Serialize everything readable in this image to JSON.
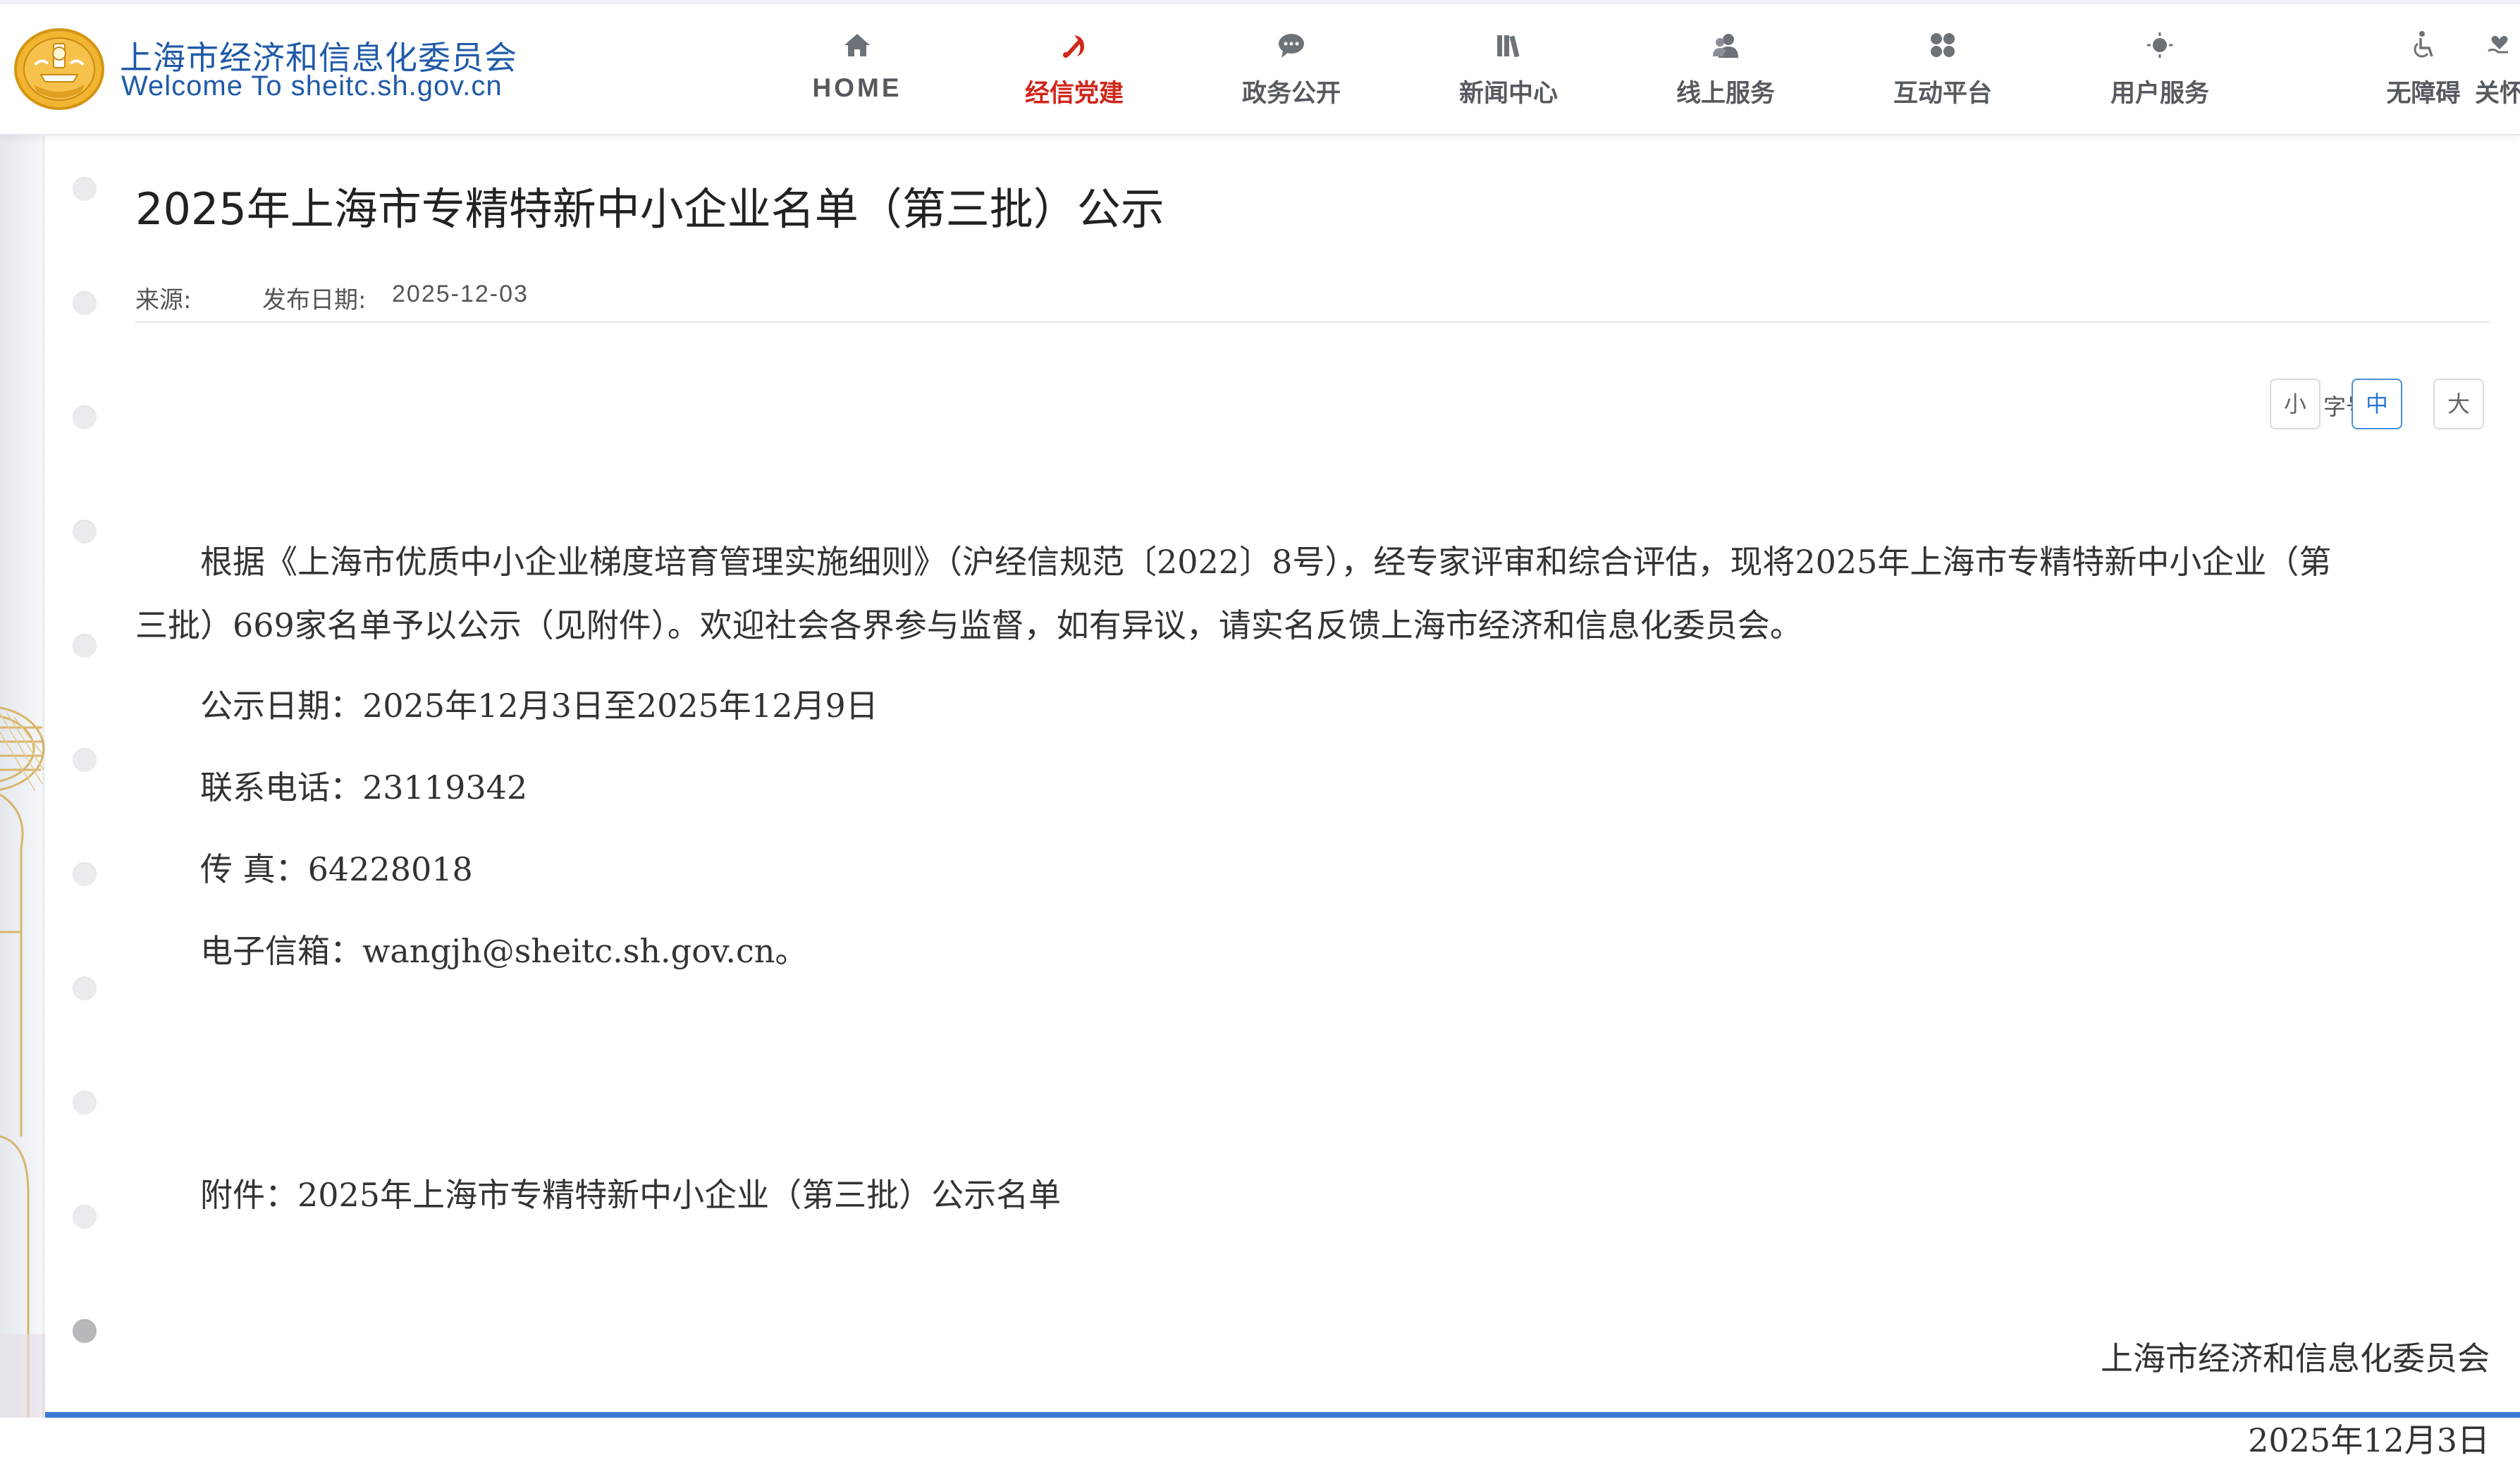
{
  "header": {
    "site_name_cn": "上海市经济和信息化委员会",
    "site_name_en": "Welcome To sheitc.sh.gov.cn",
    "nav": [
      {
        "label": "HOME",
        "icon": "home-icon"
      },
      {
        "label": "经信党建",
        "icon": "party-emblem-icon"
      },
      {
        "label": "政务公开",
        "icon": "chat-bubble-icon"
      },
      {
        "label": "新闻中心",
        "icon": "books-icon"
      },
      {
        "label": "线上服务",
        "icon": "users-icon"
      },
      {
        "label": "互动平台",
        "icon": "grid-icon"
      },
      {
        "label": "用户服务",
        "icon": "sun-icon"
      },
      {
        "label": "无障碍",
        "icon": "wheelchair-icon"
      },
      {
        "label": "关怀",
        "icon": "heart-hand-icon"
      }
    ],
    "active_color": "#d0261b"
  },
  "article": {
    "title": "2025年上海市专精特新中小企业名单（第三批）公示",
    "source_label": "来源:",
    "date_label": "发布日期:",
    "date": "2025-12-03",
    "font_size_label": "字号:",
    "font_sizes": [
      "小",
      "中",
      "大"
    ],
    "font_size_selected": "中",
    "paragraph1_line1": "根据《上海市优质中小企业梯度培育管理实施细则》（沪经信规范〔2022〕8号），经专家评审和综合评估，现将2025年上海市专精特新中小企业（第",
    "paragraph1_line2": "三批）669家名单予以公示（见附件）。欢迎社会各界参与监督，如有异议，请实名反馈上海市经济和信息化委员会。",
    "notice_period": "公示日期：2025年12月3日至2025年12月9日",
    "phone": "联系电话：23119342",
    "fax": "传 真：64228018",
    "email": "电子信箱：wangjh@sheitc.sh.gov.cn。",
    "attachment": "附件：2025年上海市专精特新中小企业（第三批）公示名单",
    "signature": "上海市经济和信息化委员会",
    "signature_date": "2025年12月3日"
  }
}
